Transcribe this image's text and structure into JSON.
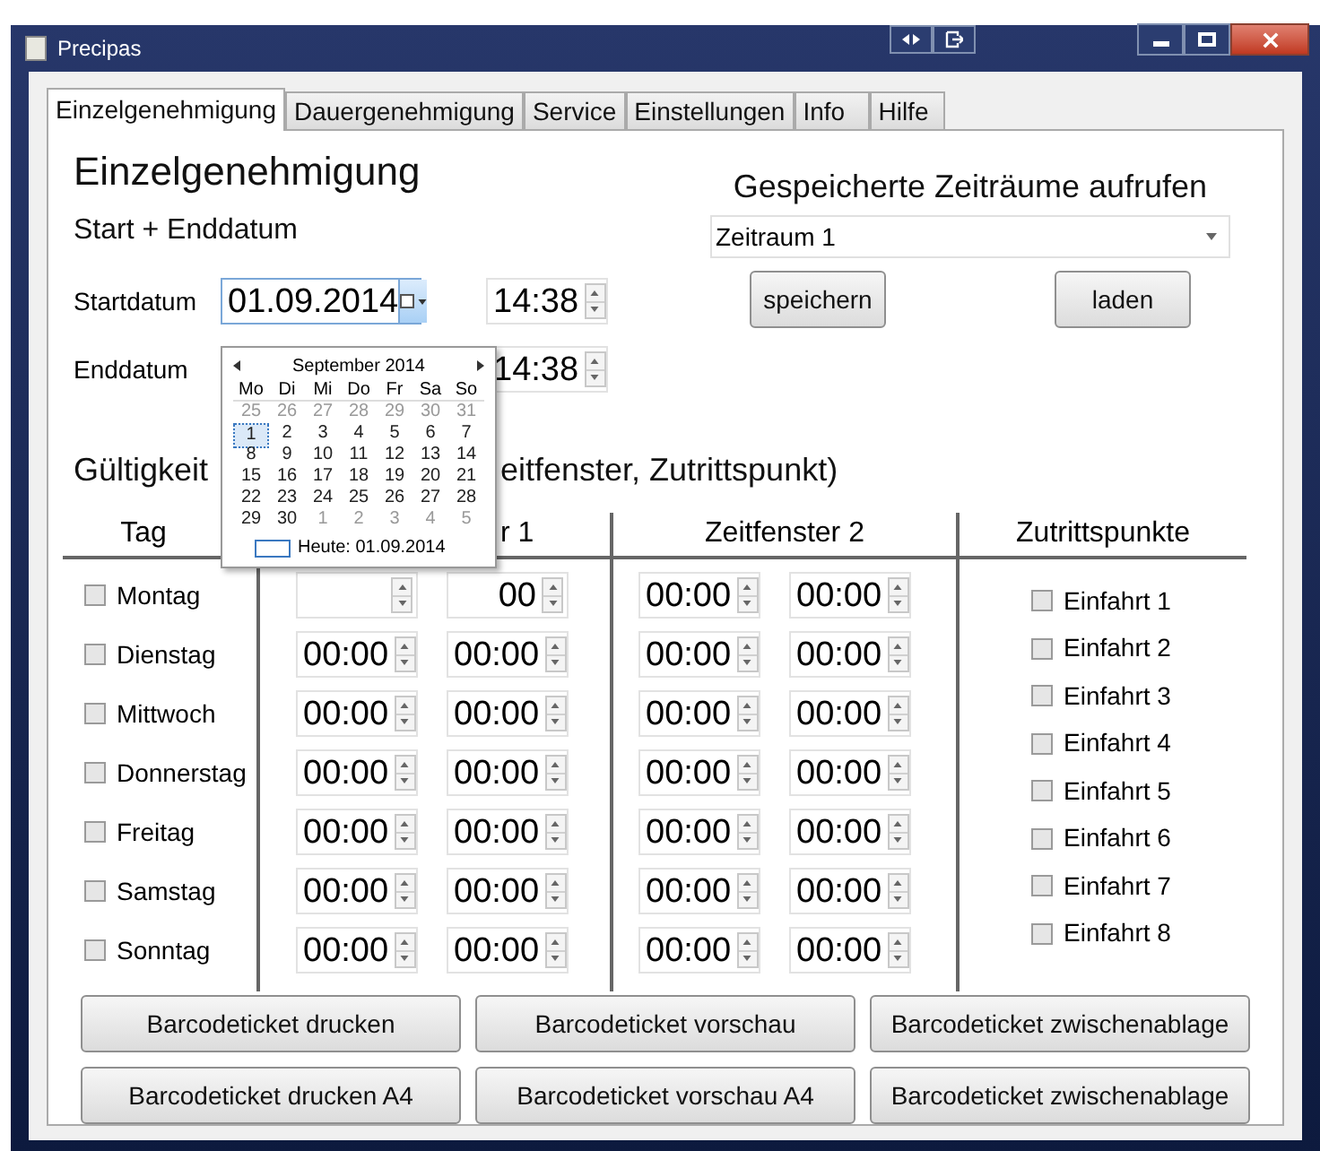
{
  "window": {
    "title": "Precipas"
  },
  "tabs": [
    {
      "label": "Einzelgenehmigung",
      "selected": true
    },
    {
      "label": "Dauergenehmigung",
      "selected": false
    },
    {
      "label": "Service",
      "selected": false
    },
    {
      "label": "Einstellungen",
      "selected": false
    },
    {
      "label": "Info",
      "selected": false
    },
    {
      "label": "Hilfe",
      "selected": false
    }
  ],
  "heading": "Einzelgenehmigung",
  "subheading": "Start + Enddatum",
  "start": {
    "label": "Startdatum",
    "date": "01.09.2014",
    "time": "14:38"
  },
  "end": {
    "label": "Enddatum",
    "time": "14:38"
  },
  "saved": {
    "title": "Gespeicherte Zeiträume aufrufen",
    "selection": "Zeitraum 1",
    "buttons": [
      "speichern",
      "laden"
    ]
  },
  "validity": {
    "title": "Gültigkeit",
    "title_rest": "eitfenster, Zutrittspunkt)"
  },
  "columns": [
    "Tag",
    "r 1",
    "Zeitfenster 2",
    "Zutrittspunkte"
  ],
  "days": [
    {
      "label": "Montag",
      "checked": false,
      "times": [
        "00",
        "00:00",
        "00:00"
      ]
    },
    {
      "label": "Dienstag",
      "checked": false,
      "times": [
        "00:00",
        "00:00",
        "00:00",
        "00:00"
      ]
    },
    {
      "label": "Mittwoch",
      "checked": false,
      "times": [
        "00:00",
        "00:00",
        "00:00",
        "00:00"
      ]
    },
    {
      "label": "Donnerstag",
      "checked": false,
      "times": [
        "00:00",
        "00:00",
        "00:00",
        "00:00"
      ]
    },
    {
      "label": "Freitag",
      "checked": false,
      "times": [
        "00:00",
        "00:00",
        "00:00",
        "00:00"
      ]
    },
    {
      "label": "Samstag",
      "checked": false,
      "times": [
        "00:00",
        "00:00",
        "00:00",
        "00:00"
      ]
    },
    {
      "label": "Sonntag",
      "checked": false,
      "times": [
        "00:00",
        "00:00",
        "00:00",
        "00:00"
      ]
    }
  ],
  "access_points": [
    {
      "label": "Einfahrt 1",
      "checked": false
    },
    {
      "label": "Einfahrt 2",
      "checked": false
    },
    {
      "label": "Einfahrt 3",
      "checked": false
    },
    {
      "label": "Einfahrt 4",
      "checked": false
    },
    {
      "label": "Einfahrt 5",
      "checked": false
    },
    {
      "label": "Einfahrt 6",
      "checked": false
    },
    {
      "label": "Einfahrt 7",
      "checked": false
    },
    {
      "label": "Einfahrt 8",
      "checked": false
    }
  ],
  "actions": [
    "Barcodeticket drucken",
    "Barcodeticket vorschau",
    "Barcodeticket zwischenablage",
    "Barcodeticket drucken A4",
    "Barcodeticket vorschau A4",
    "Barcodeticket zwischenablage"
  ],
  "calendar": {
    "month": "September 2014",
    "weekdays": [
      "Mo",
      "Di",
      "Mi",
      "Do",
      "Fr",
      "Sa",
      "So"
    ],
    "weeks": [
      [
        {
          "day": "25",
          "muted": true,
          "selected": false
        },
        {
          "day": "26",
          "muted": true,
          "selected": false
        },
        {
          "day": "27",
          "muted": true,
          "selected": false
        },
        {
          "day": "28",
          "muted": true,
          "selected": false
        },
        {
          "day": "29",
          "muted": true,
          "selected": false
        },
        {
          "day": "30",
          "muted": true,
          "selected": false
        },
        {
          "day": "31",
          "muted": true,
          "selected": false
        }
      ],
      [
        {
          "day": "1",
          "muted": false,
          "selected": true
        },
        {
          "day": "2",
          "muted": false,
          "selected": false
        },
        {
          "day": "3",
          "muted": false,
          "selected": false
        },
        {
          "day": "4",
          "muted": false,
          "selected": false
        },
        {
          "day": "5",
          "muted": false,
          "selected": false
        },
        {
          "day": "6",
          "muted": false,
          "selected": false
        },
        {
          "day": "7",
          "muted": false,
          "selected": false
        }
      ],
      [
        {
          "day": "8",
          "muted": false,
          "selected": false
        },
        {
          "day": "9",
          "muted": false,
          "selected": false
        },
        {
          "day": "10",
          "muted": false,
          "selected": false
        },
        {
          "day": "11",
          "muted": false,
          "selected": false
        },
        {
          "day": "12",
          "muted": false,
          "selected": false
        },
        {
          "day": "13",
          "muted": false,
          "selected": false
        },
        {
          "day": "14",
          "muted": false,
          "selected": false
        }
      ],
      [
        {
          "day": "15",
          "muted": false,
          "selected": false
        },
        {
          "day": "16",
          "muted": false,
          "selected": false
        },
        {
          "day": "17",
          "muted": false,
          "selected": false
        },
        {
          "day": "18",
          "muted": false,
          "selected": false
        },
        {
          "day": "19",
          "muted": false,
          "selected": false
        },
        {
          "day": "20",
          "muted": false,
          "selected": false
        },
        {
          "day": "21",
          "muted": false,
          "selected": false
        }
      ],
      [
        {
          "day": "22",
          "muted": false,
          "selected": false
        },
        {
          "day": "23",
          "muted": false,
          "selected": false
        },
        {
          "day": "24",
          "muted": false,
          "selected": false
        },
        {
          "day": "25",
          "muted": false,
          "selected": false
        },
        {
          "day": "26",
          "muted": false,
          "selected": false
        },
        {
          "day": "27",
          "muted": false,
          "selected": false
        },
        {
          "day": "28",
          "muted": false,
          "selected": false
        }
      ],
      [
        {
          "day": "29",
          "muted": false,
          "selected": false
        },
        {
          "day": "30",
          "muted": false,
          "selected": false
        },
        {
          "day": "1",
          "muted": true,
          "selected": false
        },
        {
          "day": "2",
          "muted": true,
          "selected": false
        },
        {
          "day": "3",
          "muted": true,
          "selected": false
        },
        {
          "day": "4",
          "muted": true,
          "selected": false
        },
        {
          "day": "5",
          "muted": true,
          "selected": false
        }
      ]
    ],
    "today": "Heute: 01.09.2014"
  }
}
